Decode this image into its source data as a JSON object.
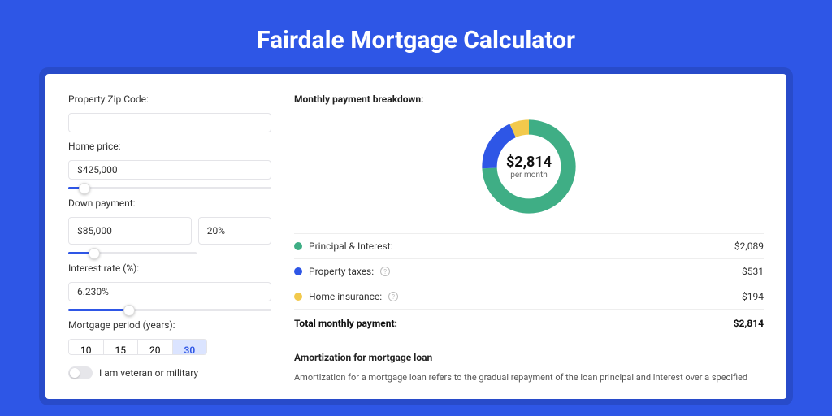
{
  "title": "Fairdale Mortgage Calculator",
  "form": {
    "zip_label": "Property Zip Code:",
    "zip_value": "",
    "home_price_label": "Home price:",
    "home_price_value": "$425,000",
    "home_price_pct": 8,
    "down_payment_label": "Down payment:",
    "down_payment_value": "$85,000",
    "down_payment_pct_value": "20%",
    "down_payment_slider_pct": 20,
    "rate_label": "Interest rate (%):",
    "rate_value": "6.230%",
    "rate_slider_pct": 30,
    "period_label": "Mortgage period (years):",
    "terms": [
      "10",
      "15",
      "20",
      "30"
    ],
    "term_active_index": 3,
    "veteran_label": "I am veteran or military"
  },
  "breakdown": {
    "title": "Monthly payment breakdown:",
    "center_amount": "$2,814",
    "center_sub": "per month",
    "items": [
      {
        "label": "Principal & Interest:",
        "value": "$2,089",
        "color": "#3fae85",
        "info": false
      },
      {
        "label": "Property taxes:",
        "value": "$531",
        "color": "#2e56e6",
        "info": true
      },
      {
        "label": "Home insurance:",
        "value": "$194",
        "color": "#f2c94c",
        "info": true
      }
    ],
    "total_label": "Total monthly payment:",
    "total_value": "$2,814"
  },
  "amort": {
    "title": "Amortization for mortgage loan",
    "text": "Amortization for a mortgage loan refers to the gradual repayment of the loan principal and interest over a specified"
  },
  "chart_data": {
    "type": "pie",
    "title": "Monthly payment breakdown",
    "series": [
      {
        "name": "Principal & Interest",
        "value": 2089,
        "color": "#3fae85"
      },
      {
        "name": "Property taxes",
        "value": 531,
        "color": "#2e56e6"
      },
      {
        "name": "Home insurance",
        "value": 194,
        "color": "#f2c94c"
      }
    ],
    "total": 2814
  }
}
